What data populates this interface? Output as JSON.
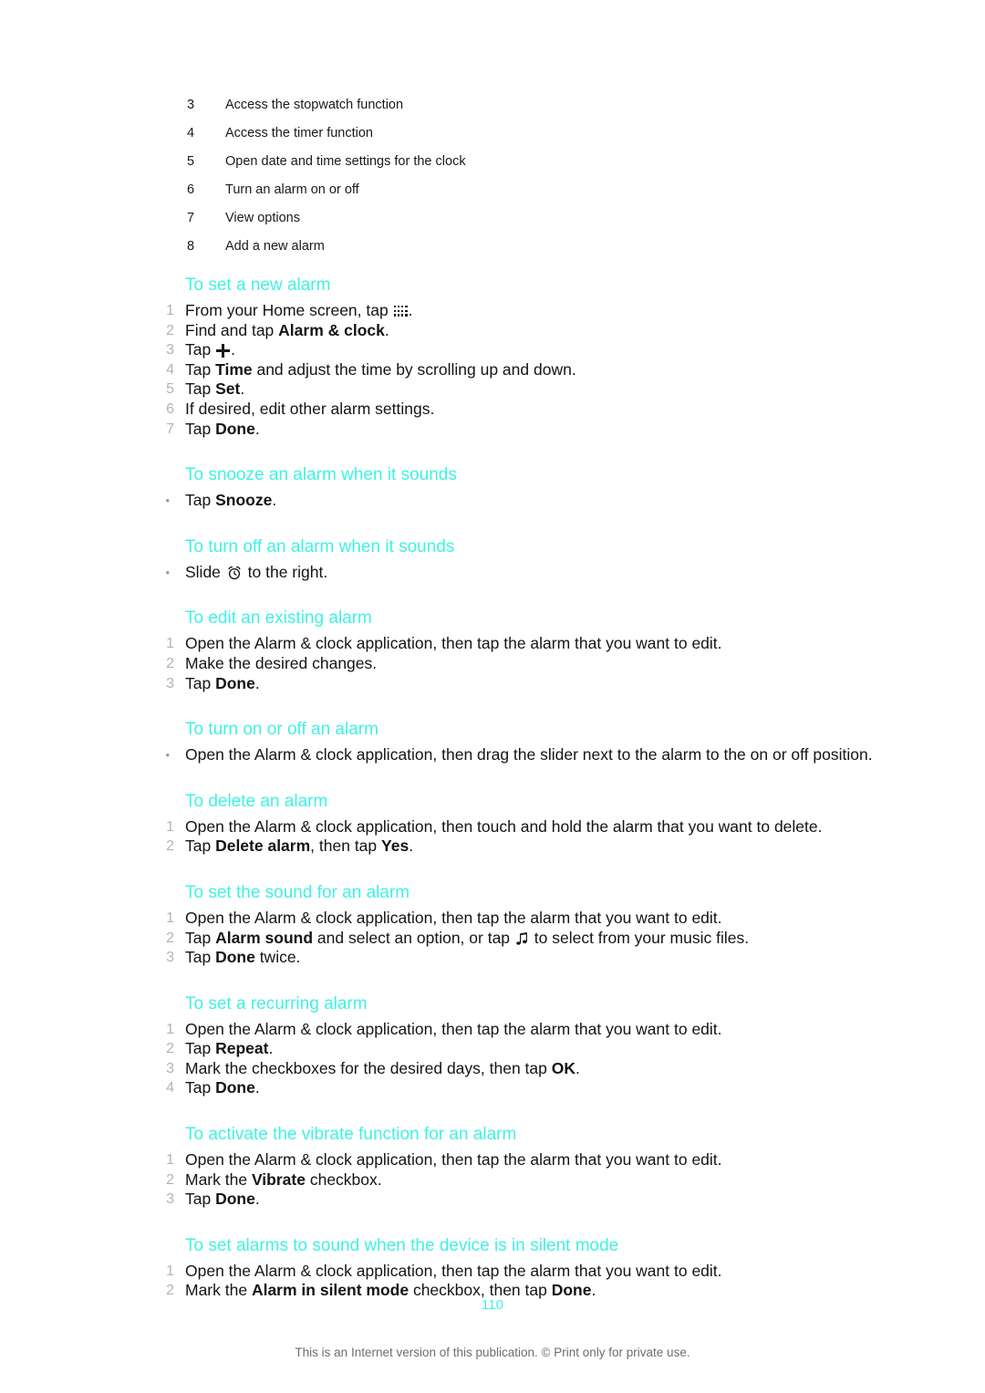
{
  "document": {
    "page_number": "110",
    "footer_note": "This is an Internet version of this publication. © Print only for private use.",
    "heading_color": "#3ff2e2",
    "body_color": "#151515",
    "marker_color": "#b3b3b3"
  },
  "legend": {
    "rows": [
      {
        "num": "3",
        "text": "Access the stopwatch function"
      },
      {
        "num": "4",
        "text": "Access the timer function"
      },
      {
        "num": "5",
        "text": "Open date and time settings for the clock"
      },
      {
        "num": "6",
        "text": "Turn an alarm on or off"
      },
      {
        "num": "7",
        "text": "View options"
      },
      {
        "num": "8",
        "text": "Add a new alarm"
      }
    ]
  },
  "sections": [
    {
      "heading": "To set a new alarm",
      "steps": [
        {
          "marker": "1",
          "pre": "From your Home screen, tap ",
          "icon": "apps-grid-icon",
          "post": "."
        },
        {
          "marker": "2",
          "pre": "Find and tap ",
          "bold": "Alarm & clock",
          "post": "."
        },
        {
          "marker": "3",
          "pre": "Tap ",
          "icon": "plus-icon",
          "post": "."
        },
        {
          "marker": "4",
          "pre": "Tap ",
          "bold": "Time",
          "post": " and adjust the time by scrolling up and down."
        },
        {
          "marker": "5",
          "pre": "Tap ",
          "bold": "Set",
          "post": "."
        },
        {
          "marker": "6",
          "pre": "If desired, edit other alarm settings.",
          "post": ""
        },
        {
          "marker": "7",
          "pre": "Tap ",
          "bold": "Done",
          "post": "."
        }
      ]
    },
    {
      "heading": "To snooze an alarm when it sounds",
      "steps": [
        {
          "marker": "•",
          "pre": "Tap ",
          "bold": "Snooze",
          "post": "."
        }
      ]
    },
    {
      "heading": "To turn off an alarm when it sounds",
      "steps": [
        {
          "marker": "•",
          "pre": "Slide ",
          "icon": "alarm-clock-icon",
          "post": " to the right."
        }
      ]
    },
    {
      "heading": "To edit an existing alarm",
      "steps": [
        {
          "marker": "1",
          "pre": "Open the Alarm & clock application, then tap the alarm that you want to edit.",
          "post": ""
        },
        {
          "marker": "2",
          "pre": "Make the desired changes.",
          "post": ""
        },
        {
          "marker": "3",
          "pre": "Tap ",
          "bold": "Done",
          "post": "."
        }
      ]
    },
    {
      "heading": "To turn on or off an alarm",
      "steps": [
        {
          "marker": "•",
          "pre": "Open the Alarm & clock application, then drag the slider next to the alarm to the on or off position.",
          "post": ""
        }
      ]
    },
    {
      "heading": "To delete an alarm",
      "steps": [
        {
          "marker": "1",
          "pre": "Open the Alarm & clock application, then touch and hold the alarm that you want to delete.",
          "post": ""
        },
        {
          "marker": "2",
          "pre": "Tap ",
          "bold": "Delete alarm",
          "mid": ", then tap ",
          "bold2": "Yes",
          "post": "."
        }
      ]
    },
    {
      "heading": "To set the sound for an alarm",
      "steps": [
        {
          "marker": "1",
          "pre": "Open the Alarm & clock application, then tap the alarm that you want to edit.",
          "post": ""
        },
        {
          "marker": "2",
          "pre": "Tap ",
          "bold": "Alarm sound",
          "mid": " and select an option, or tap ",
          "icon": "music-note-icon",
          "post": " to select from your music files."
        },
        {
          "marker": "3",
          "pre": "Tap ",
          "bold": "Done",
          "post": " twice."
        }
      ]
    },
    {
      "heading": "To set a recurring alarm",
      "steps": [
        {
          "marker": "1",
          "pre": "Open the Alarm & clock application, then tap the alarm that you want to edit.",
          "post": ""
        },
        {
          "marker": "2",
          "pre": "Tap ",
          "bold": "Repeat",
          "post": "."
        },
        {
          "marker": "3",
          "pre": "Mark the checkboxes for the desired days, then tap ",
          "bold": "OK",
          "post": "."
        },
        {
          "marker": "4",
          "pre": "Tap ",
          "bold": "Done",
          "post": "."
        }
      ]
    },
    {
      "heading": "To activate the vibrate function for an alarm",
      "steps": [
        {
          "marker": "1",
          "pre": "Open the Alarm & clock application, then tap the alarm that you want to edit.",
          "post": ""
        },
        {
          "marker": "2",
          "pre": "Mark the ",
          "bold": "Vibrate",
          "post": " checkbox."
        },
        {
          "marker": "3",
          "pre": "Tap ",
          "bold": "Done",
          "post": "."
        }
      ]
    },
    {
      "heading": "To set alarms to sound when the device is in silent mode",
      "steps": [
        {
          "marker": "1",
          "pre": "Open the Alarm & clock application, then tap the alarm that you want to edit.",
          "post": ""
        },
        {
          "marker": "2",
          "pre": "Mark the ",
          "bold": "Alarm in silent mode",
          "mid": " checkbox, then tap ",
          "bold2": "Done",
          "post": "."
        }
      ]
    }
  ]
}
